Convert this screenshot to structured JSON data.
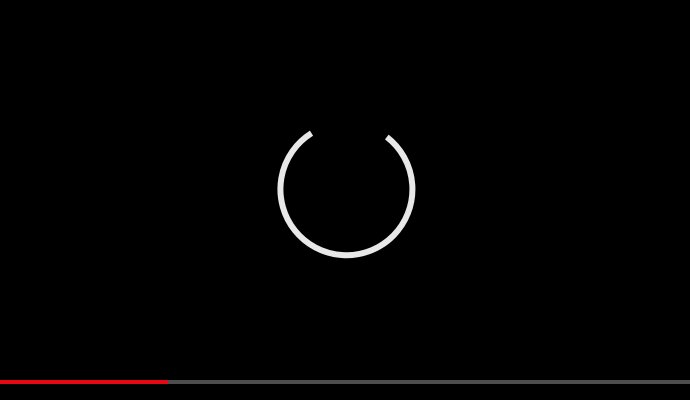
{
  "player": {
    "state_icon": "loading-spinner-icon",
    "progress_fraction": 0.244,
    "colors": {
      "background": "#000000",
      "spinner": "#e8e8e8",
      "progress_played": "#e50914",
      "progress_track": "#4d4d4d"
    }
  }
}
